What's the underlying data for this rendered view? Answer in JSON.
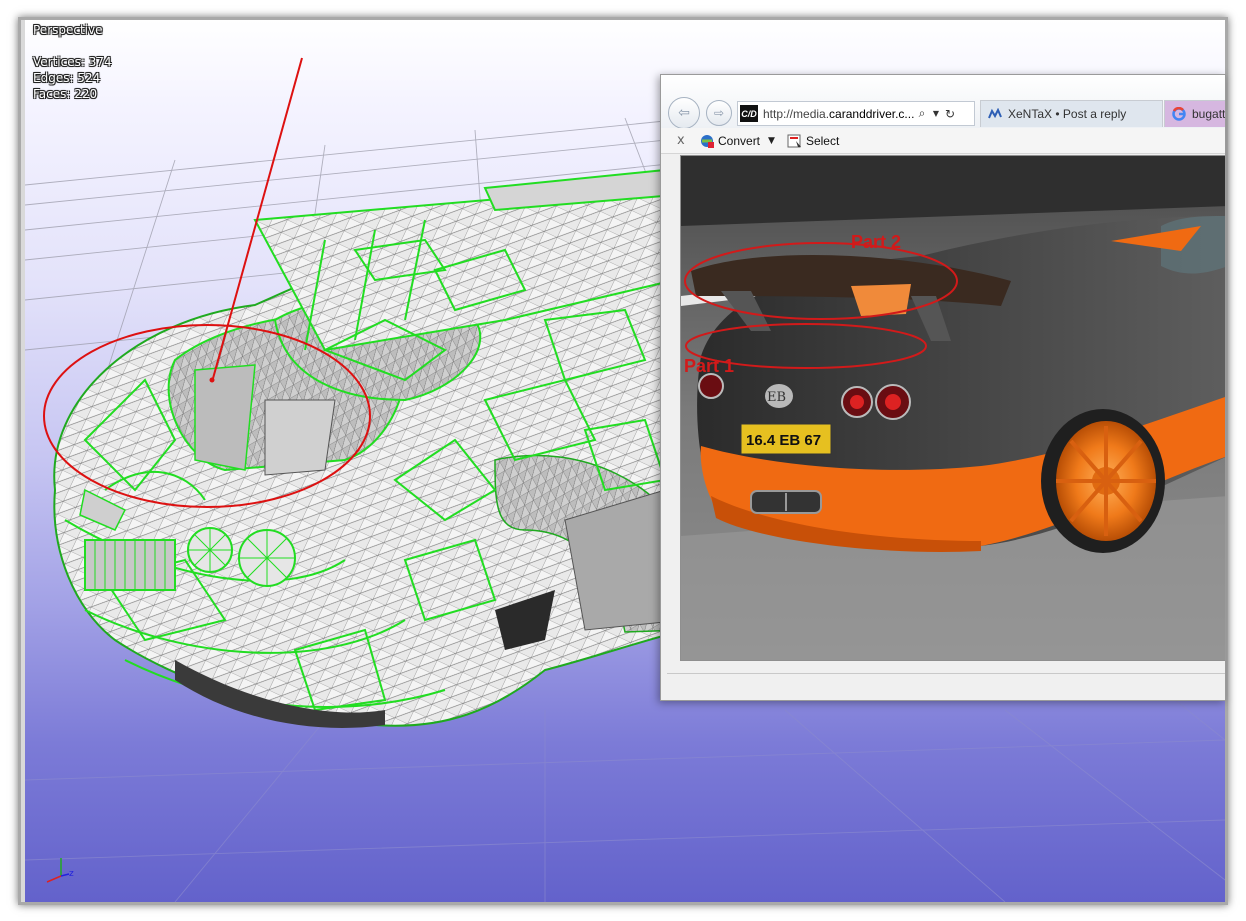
{
  "viewport": {
    "view_label": "Perspective",
    "stats": {
      "vertices": "Vertices: 374",
      "edges": "Edges: 524",
      "faces": "Faces: 220"
    },
    "colors": {
      "wireframe_highlight": "#22dd22",
      "annotation": "#dd1111",
      "background_top": "#ffffff",
      "background_bottom": "#6362cb"
    },
    "axis_gizmo_icon": "xyz-axis-icon"
  },
  "browser": {
    "url_prefix": "http://media.",
    "url_domain": "caranddriver.c...",
    "site_icon_text": "C/D",
    "tabs": [
      {
        "label": "XeNTaX • Post a reply",
        "icon": "forum-icon"
      },
      {
        "label": "bugatti",
        "icon": "google-icon"
      }
    ],
    "command_bar": {
      "close_glyph": "x",
      "convert_label": "Convert",
      "select_label": "Select"
    },
    "photo": {
      "annotations": [
        "Part 2",
        "Part 1"
      ],
      "plate_text": "16.4  EB  67",
      "badge_text": "EB"
    }
  }
}
